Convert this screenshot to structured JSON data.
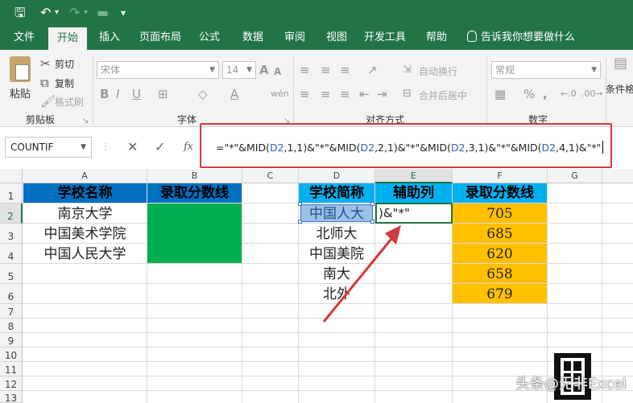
{
  "quick_access": {
    "save_icon": "save-icon",
    "undo_icon": "undo-icon",
    "redo_icon": "redo-icon",
    "folder_icon": "folder-icon"
  },
  "tabs": [
    "文件",
    "开始",
    "插入",
    "页面布局",
    "公式",
    "数据",
    "审阅",
    "视图",
    "开发工具",
    "帮助"
  ],
  "active_tab": "开始",
  "tell_me": "告诉我你想要做什么",
  "ribbon": {
    "paste": "粘贴",
    "cut": "剪切",
    "copy": "复制",
    "format_painter": "格式刷",
    "clipboard": "剪贴板",
    "font_name": "宋体",
    "font_size": "14",
    "font_group": "字体",
    "wrap_text": "自动换行",
    "merge_center": "合并后居中",
    "alignment_group": "对齐方式",
    "number_format": "常规",
    "number_group": "数字",
    "conditional_format": "条件格"
  },
  "formula_bar": {
    "name_box": "COUNTIF",
    "cancel": "✕",
    "enter": "✓",
    "fx": "fx",
    "formula": "=\"*\"&MID(D2,1,1)&\"*\"&MID(D2,2,1)&\"*\"&MID(D2,3,1)&\"*\"&MID(D2,4,1)&\"*\""
  },
  "columns": [
    "A",
    "B",
    "C",
    "D",
    "E",
    "F",
    "G"
  ],
  "rows": [
    "1",
    "2",
    "3",
    "4",
    "5",
    "6",
    "7",
    "8",
    "9",
    "10",
    "11",
    "12",
    "13"
  ],
  "table_left": {
    "headers": [
      "学校名称",
      "录取分数线"
    ],
    "names": [
      "南京大学",
      "中国美术学院",
      "中国人民大学"
    ]
  },
  "table_right": {
    "headers": [
      "学校简称",
      "辅助列",
      "录取分数线"
    ],
    "short_names": [
      "中国人大",
      "北师大",
      "中国美院",
      "南大",
      "北外"
    ],
    "scores": [
      "705",
      "685",
      "620",
      "658",
      "679"
    ]
  },
  "edit_cell_text": ")&\"*\"",
  "watermark": "头条@无非Excel",
  "colors": {
    "excel_green": "#227447",
    "header_blue": "#0070c0",
    "header_cyan": "#00b0f0",
    "fill_green": "#00b050",
    "fill_orange": "#ffc000",
    "annotation_red": "#d33a3a"
  }
}
